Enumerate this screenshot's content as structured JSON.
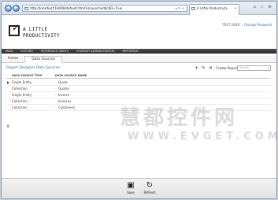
{
  "browser": {
    "address": "http://localhost:18490/default.html?isLaunched$c6D=True",
    "address_tools": "▾ ↻ ×",
    "tab_title": "A Little Productivity",
    "tab_close": "×",
    "window_tools": "⌂ ☆ ⚙"
  },
  "header": {
    "logo_line1": "A LITTLE",
    "logo_line2": "PRODUCTIVITY",
    "user": "TEST USER",
    "separator": "|",
    "change_password": "Change Password"
  },
  "menu": [
    "MAIN",
    "COSTING",
    "REFERENCE TABLES",
    "COMPANY ADMINISTRATION",
    "REPORTING"
  ],
  "tabs": [
    {
      "label": "Home"
    },
    {
      "label": "Data Sources"
    }
  ],
  "panel": {
    "title": "Report Designer Data Sources",
    "add_icon": "+",
    "edit_icon": "✎",
    "delete_icon": "✕",
    "create_report": "Create Report",
    "search_placeholder": "Search",
    "search_icon": "⌕"
  },
  "grid": {
    "columns": [
      "DATA SOURCE TYPE",
      "DATA SOURCE NAME"
    ],
    "rows": [
      {
        "type": "Single Entity",
        "name": "Quote",
        "selected": true
      },
      {
        "type": "Collection",
        "name": "Quotes"
      },
      {
        "type": "Single Entity",
        "name": "Invoice"
      },
      {
        "type": "Collection",
        "name": "Invoices"
      },
      {
        "type": "Collection",
        "name": "Customers"
      }
    ],
    "row_arrow": "▶",
    "footer_icon": "⚙"
  },
  "pager": {
    "prev": "◂",
    "current": "1",
    "next": "▸"
  },
  "design_screen": "Design Screen",
  "bottom_toolbar": {
    "save_icon": "▣",
    "save": "Save",
    "refresh_icon": "↻",
    "refresh": "Refresh"
  },
  "watermark": {
    "cn": "慧都控件网",
    "en": "WWW.EVGET.COM"
  }
}
